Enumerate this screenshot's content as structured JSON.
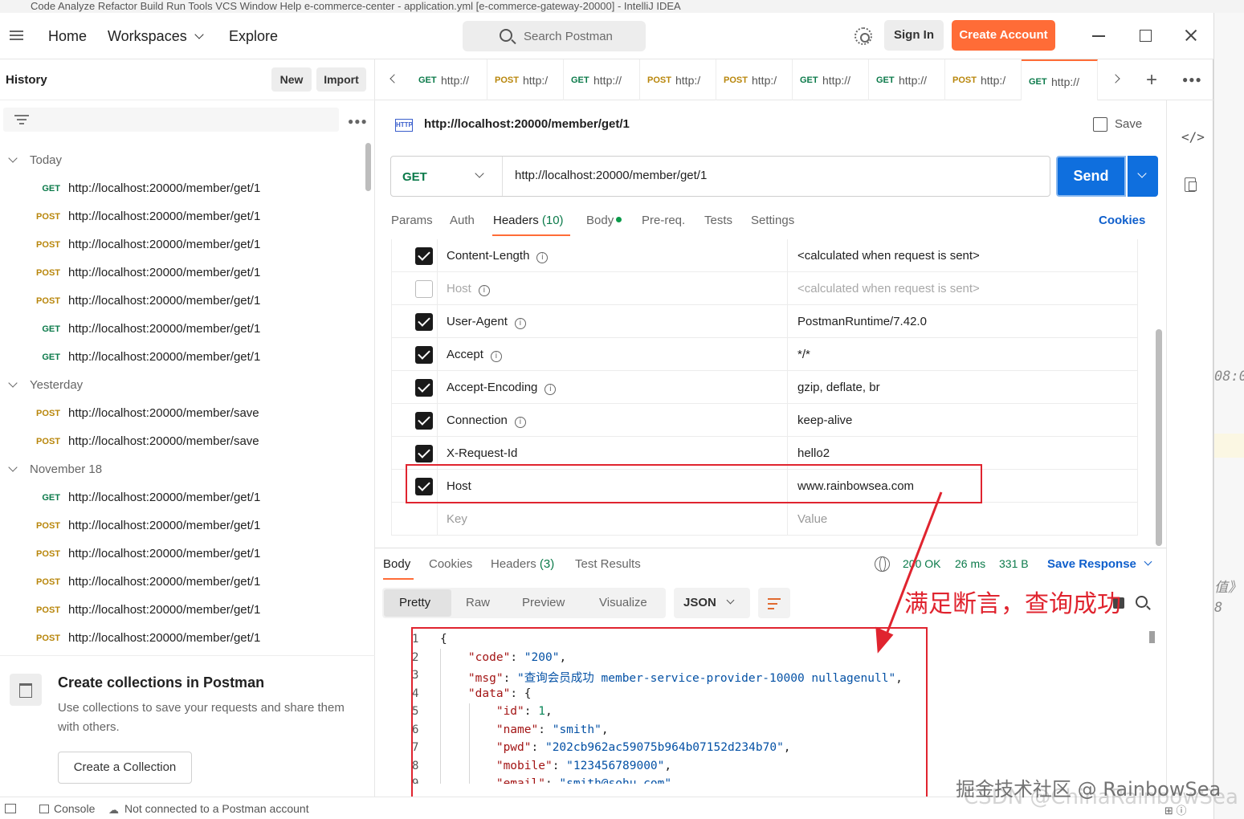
{
  "background": {
    "ide_title": "Code  Analyze  Refactor  Build  Run  Tools  VCS  Window  Help    e-commerce-center - application.yml [e-commerce-gateway-20000] - IntelliJ IDEA",
    "frag_time": "08:0",
    "frag_value": "值》",
    "frag_num": "8"
  },
  "header": {
    "nav": {
      "home": "Home",
      "workspaces": "Workspaces",
      "explore": "Explore"
    },
    "search_placeholder": "Search Postman",
    "sign_in": "Sign In",
    "create_account": "Create Account"
  },
  "sidebar": {
    "title": "History",
    "new_label": "New",
    "import_label": "Import",
    "groups": [
      {
        "label": "Today",
        "items": [
          {
            "method": "GET",
            "url": "http://localhost:20000/member/get/1"
          },
          {
            "method": "POST",
            "url": "http://localhost:20000/member/get/1"
          },
          {
            "method": "POST",
            "url": "http://localhost:20000/member/get/1"
          },
          {
            "method": "POST",
            "url": "http://localhost:20000/member/get/1"
          },
          {
            "method": "POST",
            "url": "http://localhost:20000/member/get/1"
          },
          {
            "method": "GET",
            "url": "http://localhost:20000/member/get/1"
          },
          {
            "method": "GET",
            "url": "http://localhost:20000/member/get/1"
          }
        ]
      },
      {
        "label": "Yesterday",
        "items": [
          {
            "method": "POST",
            "url": "http://localhost:20000/member/save"
          },
          {
            "method": "POST",
            "url": "http://localhost:20000/member/save"
          }
        ]
      },
      {
        "label": "November 18",
        "items": [
          {
            "method": "GET",
            "url": "http://localhost:20000/member/get/1"
          },
          {
            "method": "POST",
            "url": "http://localhost:20000/member/get/1"
          },
          {
            "method": "POST",
            "url": "http://localhost:20000/member/get/1"
          },
          {
            "method": "POST",
            "url": "http://localhost:20000/member/get/1"
          },
          {
            "method": "POST",
            "url": "http://localhost:20000/member/get/1"
          },
          {
            "method": "POST",
            "url": "http://localhost:20000/member/get/1"
          }
        ]
      }
    ],
    "collections": {
      "title": "Create collections in Postman",
      "description": "Use collections to save your requests and share them with others.",
      "button": "Create a Collection"
    }
  },
  "tabs": [
    {
      "method": "GET",
      "url": "http://"
    },
    {
      "method": "POST",
      "url": "http:/"
    },
    {
      "method": "GET",
      "url": "http://"
    },
    {
      "method": "POST",
      "url": "http:/"
    },
    {
      "method": "POST",
      "url": "http:/"
    },
    {
      "method": "GET",
      "url": "http://"
    },
    {
      "method": "GET",
      "url": "http://"
    },
    {
      "method": "POST",
      "url": "http:/"
    },
    {
      "method": "GET",
      "url": "http://",
      "active": true
    }
  ],
  "request": {
    "title": "http://localhost:20000/member/get/1",
    "save_label": "Save",
    "method": "GET",
    "url": "http://localhost:20000/member/get/1",
    "send_label": "Send",
    "subtabs": {
      "params": "Params",
      "auth": "Auth",
      "headers": "Headers",
      "headers_count": "(10)",
      "body": "Body",
      "prereq": "Pre-req.",
      "tests": "Tests",
      "settings": "Settings",
      "cookies": "Cookies"
    },
    "headers": [
      {
        "checked": true,
        "key": "Content-Length",
        "info": true,
        "value": "<calculated when request is sent>"
      },
      {
        "checked": false,
        "key": "Host",
        "info": true,
        "value": "<calculated when request is sent>"
      },
      {
        "checked": true,
        "key": "User-Agent",
        "info": true,
        "value": "PostmanRuntime/7.42.0"
      },
      {
        "checked": true,
        "key": "Accept",
        "info": true,
        "value": "*/*"
      },
      {
        "checked": true,
        "key": "Accept-Encoding",
        "info": true,
        "value": "gzip, deflate, br"
      },
      {
        "checked": true,
        "key": "Connection",
        "info": true,
        "value": "keep-alive"
      },
      {
        "checked": true,
        "key": "X-Request-Id",
        "info": false,
        "value": "hello2"
      },
      {
        "checked": true,
        "key": "Host",
        "info": false,
        "value": "www.rainbowsea.com"
      }
    ],
    "placeholder_key": "Key",
    "placeholder_value": "Value"
  },
  "response": {
    "tabs": {
      "body": "Body",
      "cookies": "Cookies",
      "headers": "Headers",
      "headers_count": "(3)",
      "test_results": "Test Results"
    },
    "status": "200 OK",
    "time": "26 ms",
    "size": "331 B",
    "save_response": "Save Response",
    "views": {
      "pretty": "Pretty",
      "raw": "Raw",
      "preview": "Preview",
      "visualize": "Visualize"
    },
    "format": "JSON",
    "json": {
      "code": "200",
      "msg": "查询会员成功 member-service-provider-10000 nullagenull",
      "id": "1",
      "name": "smith",
      "pwd": "202cb962ac59075b964b07152d234b70",
      "mobile": "123456789000",
      "email": "smith@sohu.com"
    }
  },
  "annotation": "满足断言，查询成功",
  "statusbar": {
    "console": "Console",
    "status": "Not connected to a Postman account"
  },
  "watermarks": {
    "juejin": "掘金技术社区 @ RainbowSea",
    "csdn": "CSDN @ChinaRainbowSea"
  },
  "colors": {
    "accent": "#ff6c37",
    "send": "#0f6fde",
    "get": "#0b7a4a",
    "post": "#b8860b",
    "annotation": "#e0242f"
  }
}
